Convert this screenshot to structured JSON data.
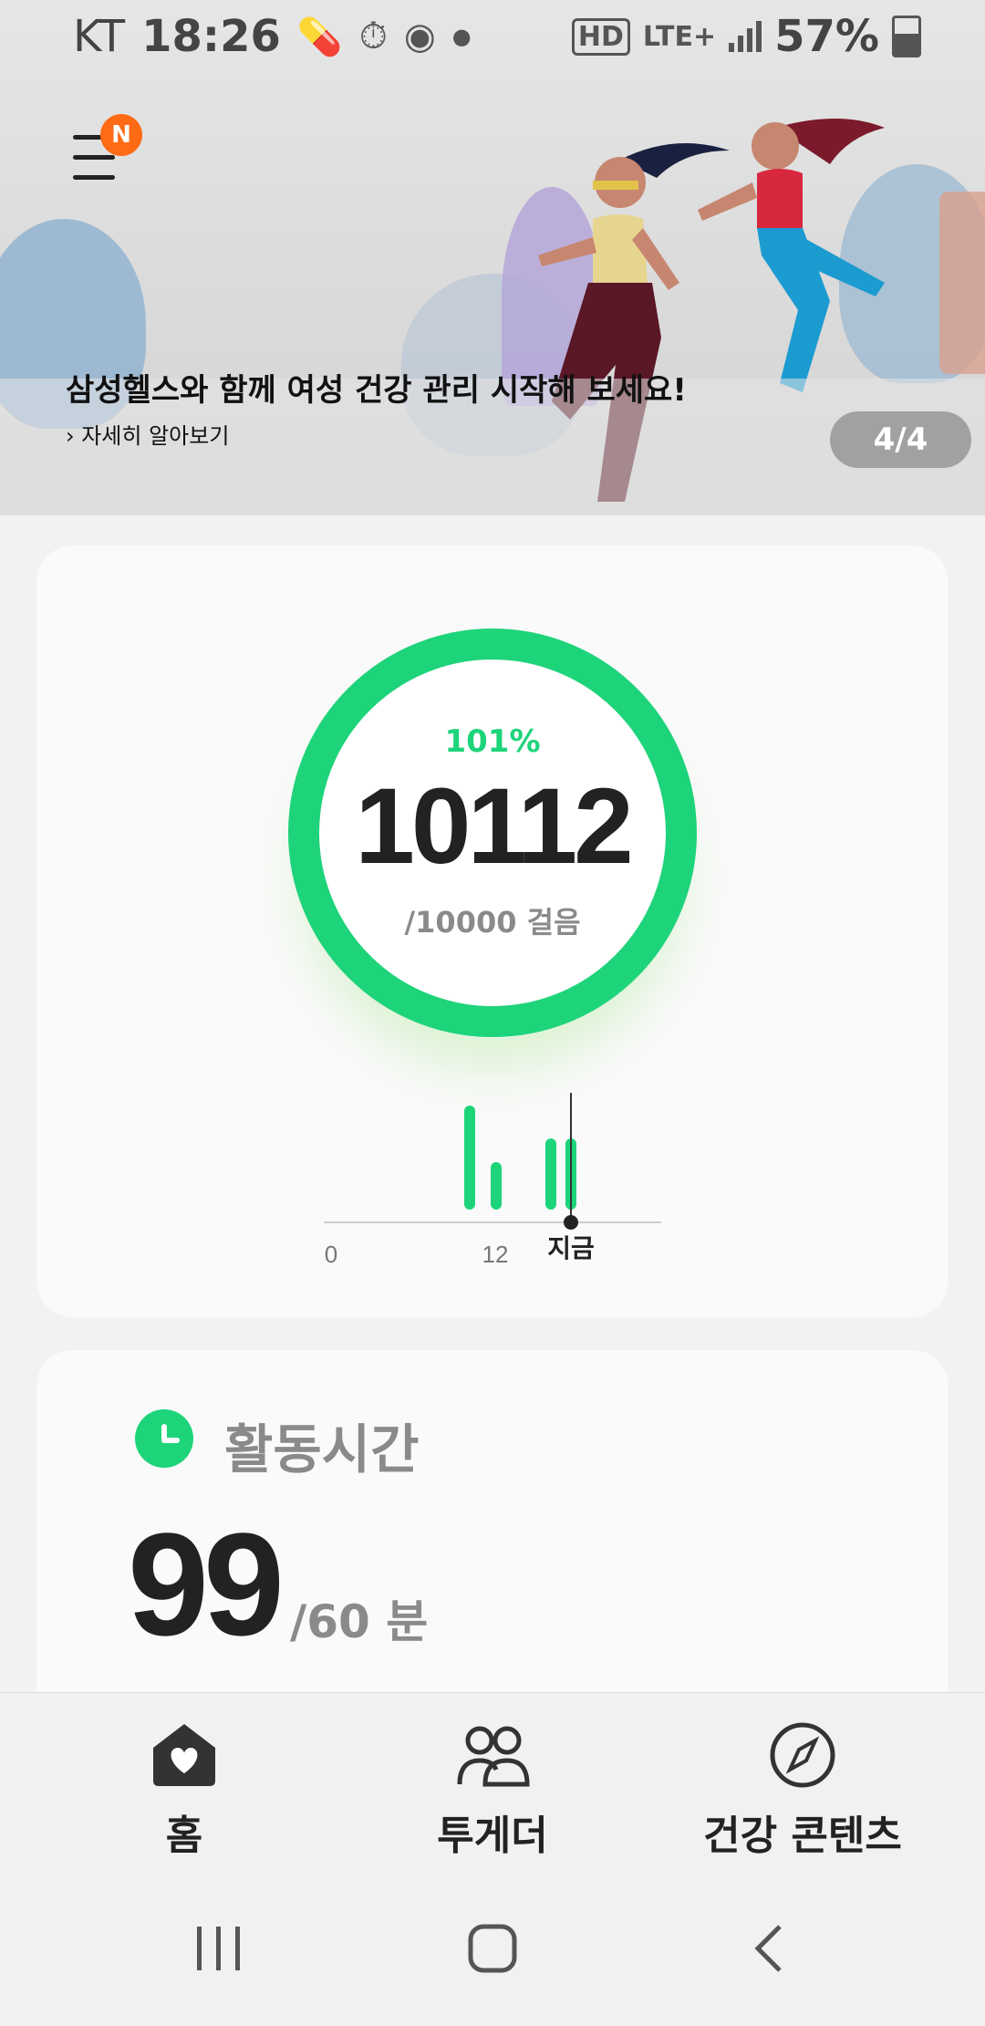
{
  "status_bar": {
    "carrier": "KT",
    "time": "18:26",
    "network_hd": "HD",
    "network_type": "LTE+",
    "battery": "57%"
  },
  "banner": {
    "badge": "N",
    "title": "삼성헬스와 함께 여성 건강 관리 시작해 보세요!",
    "link": "› 자세히 알아보기",
    "counter": "4/4"
  },
  "steps": {
    "percent": "101%",
    "value": "10112",
    "goal": "/10000 걸음",
    "progress_fraction": 1.0,
    "chart_labels": {
      "start": "0",
      "mid": "12",
      "now": "지금"
    },
    "chart_accent": "#1ed47a"
  },
  "active_time": {
    "title": "활동시간",
    "value": "99",
    "goal": "/60 분"
  },
  "nav": {
    "items": [
      {
        "label": "홈",
        "icon": "home-heart-icon"
      },
      {
        "label": "투게더",
        "icon": "people-icon"
      },
      {
        "label": "건강 콘텐츠",
        "icon": "compass-icon"
      }
    ]
  },
  "system_nav": {
    "recent": "recent-apps-icon",
    "home": "home-button-icon",
    "back": "back-icon"
  },
  "colors": {
    "accent_green": "#1ed47a",
    "badge_orange": "#ff6a14"
  }
}
